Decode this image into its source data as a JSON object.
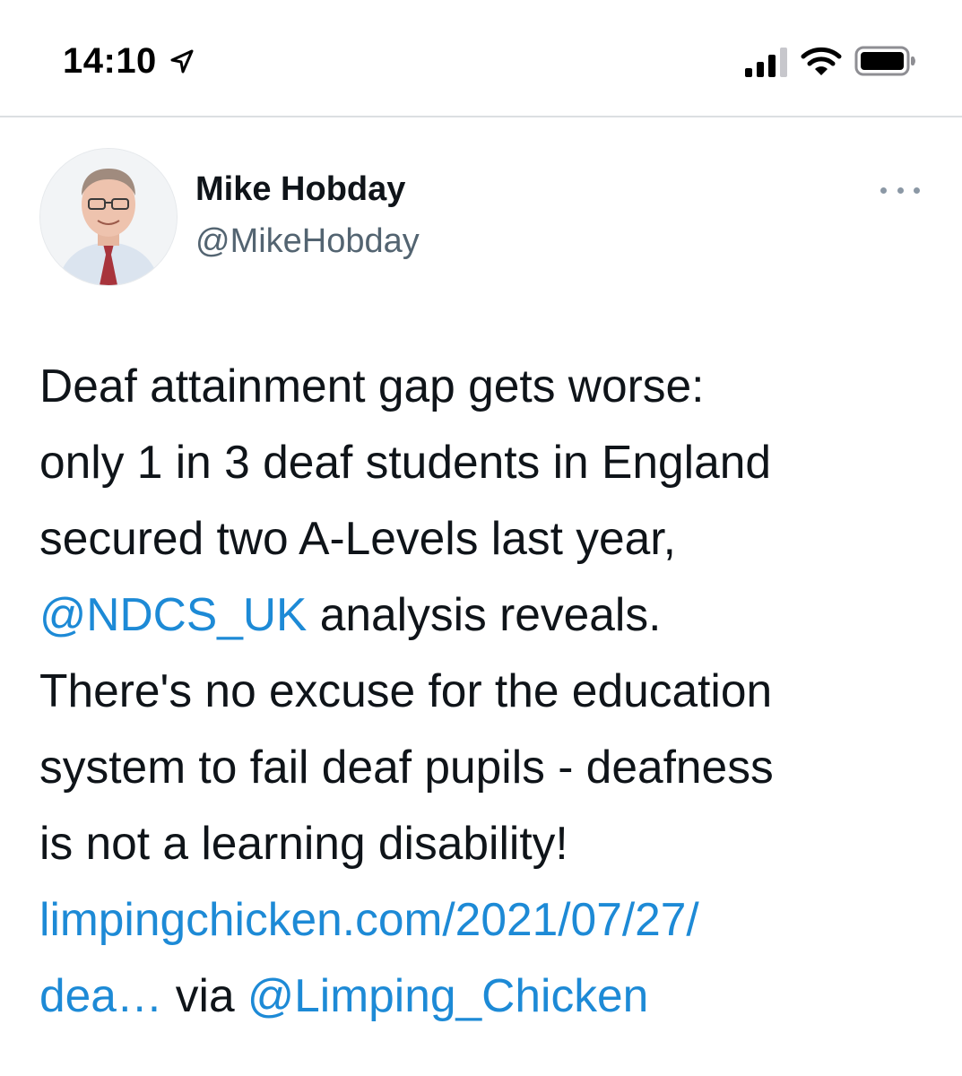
{
  "status_bar": {
    "time": "14:10",
    "location_icon": "location-arrow-icon",
    "signal_icon": "cellular-signal-icon",
    "wifi_icon": "wifi-icon",
    "battery_icon": "battery-icon"
  },
  "tweet": {
    "author": {
      "name": "Mike Hobday",
      "handle": "@MikeHobday"
    },
    "more_icon": "more-horizontal-icon",
    "lines": {
      "l1": "Deaf attainment gap gets worse:",
      "l2": "only 1 in 3 deaf students in England",
      "l3": "secured two A-Levels last year,",
      "l4_mention": "@NDCS_UK",
      "l4_rest": " analysis reveals.",
      "l5": "There's no excuse for the education",
      "l6": "system to fail deaf pupils - deafness",
      "l7": "is not a learning disability!",
      "l8_link": "limpingchicken.com/2021/07/27/",
      "l9_link": "dea…",
      "l9_via": " via ",
      "l9_mention": "@Limping_Chicken"
    }
  },
  "colors": {
    "link": "#1d8ad6",
    "text": "#0f1419",
    "secondary": "#536471",
    "divider": "#dcdfe2"
  }
}
